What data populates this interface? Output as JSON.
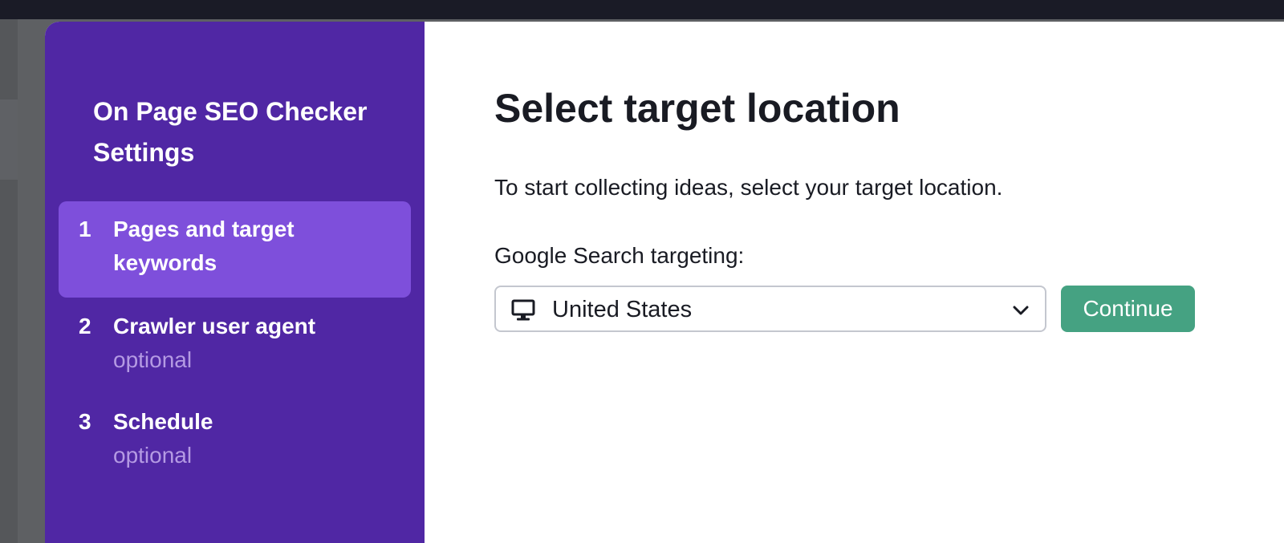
{
  "sidebar": {
    "title": "On Page SEO Checker Settings",
    "steps": [
      {
        "number": "1",
        "label": "Pages and target keywords",
        "optional": ""
      },
      {
        "number": "2",
        "label": "Crawler user agent",
        "optional": "optional"
      },
      {
        "number": "3",
        "label": "Schedule",
        "optional": "optional"
      }
    ]
  },
  "main": {
    "heading": "Select target location",
    "description": "To start collecting ideas, select your target location.",
    "field_label": "Google Search targeting:",
    "location_select": {
      "value": "United States",
      "icon": "desktop-icon"
    },
    "continue_label": "Continue"
  },
  "colors": {
    "sidebar_bg": "#5027a4",
    "active_step_bg": "#7e4fdb",
    "optional_text": "#b49ae3",
    "continue_bg": "#45a282",
    "topbar": "#1a1b26"
  }
}
